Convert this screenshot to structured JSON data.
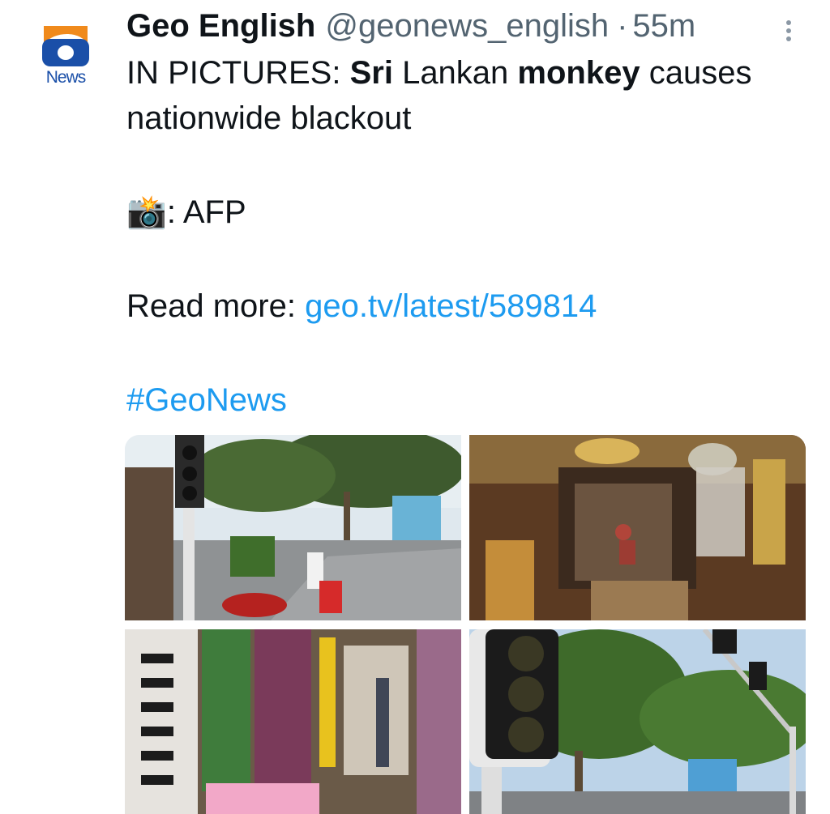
{
  "post": {
    "author_name": "Geo English",
    "handle": "@geonews_english",
    "separator": "·",
    "time": "55m",
    "avatar_label": "News",
    "line1_prefix": "IN PICTURES: ",
    "line1_bold1": "Sri",
    "line1_mid": " Lankan ",
    "line1_bold2": "monkey",
    "line1_suffix": " causes",
    "line2": "nationwide blackout",
    "camera_emoji": "📸",
    "credit": ": AFP",
    "read_more_label": "Read more: ",
    "link_text": "geo.tv/latest/589814",
    "hashtag": "#GeoNews"
  },
  "colors": {
    "link": "#1d9bf0",
    "brand_orange": "#f08a1c",
    "brand_blue": "#1a4fa8"
  },
  "icons": [
    "geo-news-logo-icon",
    "more-options-icon",
    "camera-flash-icon"
  ],
  "media": [
    {
      "name": "traffic-light-street-photo"
    },
    {
      "name": "lamp-shop-photo"
    },
    {
      "name": "cosmetics-shop-photo"
    },
    {
      "name": "traffic-lights-trees-photo"
    }
  ]
}
